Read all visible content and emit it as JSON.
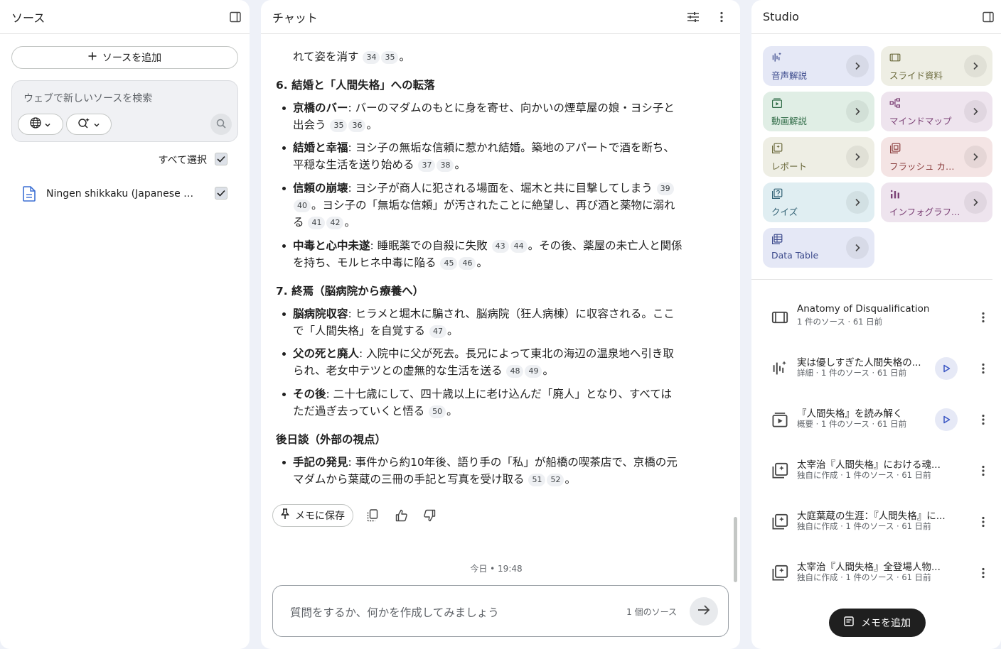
{
  "sources": {
    "title": "ソース",
    "add_label": "ソースを追加",
    "search_placeholder": "ウェブで新しいソースを検索",
    "select_all_label": "すべて選択",
    "items": [
      {
        "name": "Ningen shikkaku (Japanese Edi..."
      }
    ]
  },
  "chat": {
    "title": "チャット",
    "content": {
      "lead_text": "れて姿を消す",
      "lead_cites": [
        "34",
        "35"
      ],
      "lead_end": "。",
      "sections": [
        {
          "heading": "6. 結婚と「人間失格」への転落",
          "bullets": [
            {
              "term": "京橋のバー",
              "line1": ": バーのマダムのもとに身を寄せ、向かいの煙草屋の娘・ヨシ子と",
              "line2": "出会う",
              "cites": [
                "35",
                "36"
              ],
              "end": "。"
            },
            {
              "term": "結婚と幸福",
              "line1": ": ヨシ子の無垢な信頼に惹かれ結婚。築地のアパートで酒を断ち、",
              "line2": "平穏な生活を送り始める",
              "cites": [
                "37",
                "38"
              ],
              "end": "。"
            },
            {
              "term": "信頼の崩壊",
              "line1": ": ヨシ子が商人に犯される場面を、堀木と共に目撃してしまう",
              "cite_a": "39",
              "cite_b": "40",
              "line2": "。ヨシ子の「無垢な信頼」が汚されたことに絶望し、再び酒と薬物に溺れ",
              "line3": "る",
              "cites": [
                "41",
                "42"
              ],
              "end": "。"
            },
            {
              "term": "中毒と心中未遂",
              "line1": ": 睡眠薬での自殺に失敗",
              "cite_a": "43",
              "cite_b": "44",
              "line1b": "。その後、薬屋の未亡人と関係",
              "line2": "を持ち、モルヒネ中毒に陥る",
              "cites": [
                "45",
                "46"
              ],
              "end": "。"
            }
          ]
        },
        {
          "heading": "7. 終焉（脳病院から療養へ）",
          "bullets": [
            {
              "term": "脳病院収容",
              "line1": ": ヒラメと堀木に騙され、脳病院（狂人病棟）に収容される。ここ",
              "line2": "で「人間失格」を自覚する",
              "cites": [
                "47"
              ],
              "end": "。"
            },
            {
              "term": "父の死と廃人",
              "line1": ": 入院中に父が死去。長兄によって東北の海辺の温泉地へ引き取",
              "line2": "られ、老女中テツとの虚無的な生活を送る",
              "cites": [
                "48",
                "49"
              ],
              "end": "。"
            },
            {
              "term": "その後",
              "line1": ": 二十七歳にして、四十歳以上に老け込んだ「廃人」となり、すべては",
              "line2": "ただ過ぎ去っていくと悟る",
              "cites": [
                "50"
              ],
              "end": "。"
            }
          ]
        },
        {
          "heading": "後日談（外部の視点）",
          "bullets": [
            {
              "term": "手記の発見",
              "line1": ": 事件から約10年後、語り手の「私」が船橋の喫茶店で、京橋の元",
              "line2": "マダムから葉蔵の三冊の手記と写真を受け取る",
              "cites": [
                "51",
                "52"
              ],
              "end": "。"
            }
          ]
        }
      ]
    },
    "save_memo_label": "メモに保存",
    "timestamp": "今日 • 19:48",
    "input_placeholder": "質問をするか、何かを作成してみましょう",
    "source_count": "1 個のソース"
  },
  "studio": {
    "title": "Studio",
    "tiles": [
      {
        "label": "音声解説",
        "icon": "audio-sparkle-icon",
        "bg": "#e5e8f6",
        "color": "#3c4a8c"
      },
      {
        "label": "スライド資料",
        "icon": "slides-icon",
        "bg": "#eeeee4",
        "color": "#6b6a3c"
      },
      {
        "label": "動画解説",
        "icon": "video-icon",
        "bg": "#e0eee5",
        "color": "#2f6b46"
      },
      {
        "label": "マインドマップ",
        "icon": "mindmap-icon",
        "bg": "#eee4ee",
        "color": "#7a3f74"
      },
      {
        "label": "レポート",
        "icon": "report-icon",
        "bg": "#eeeee4",
        "color": "#6b6a3c"
      },
      {
        "label": "フラッシュ カード",
        "icon": "flashcard-icon",
        "bg": "#f4e4e4",
        "color": "#8c3f3f"
      },
      {
        "label": "クイズ",
        "icon": "quiz-icon",
        "bg": "#e0eef2",
        "color": "#2f5f72"
      },
      {
        "label": "インフォグラフィ...",
        "icon": "infographic-icon",
        "bg": "#eee4ee",
        "color": "#7a3f74"
      },
      {
        "label": "Data Table",
        "icon": "table-icon",
        "bg": "#e5e8f6",
        "color": "#3c4a8c"
      }
    ],
    "notes": [
      {
        "title": "Anatomy of Disqualification",
        "sub": "1 件のソース · 61 日前",
        "icon": "slides-icon",
        "play": false
      },
      {
        "title": "実は優しすぎた人間失格の...",
        "sub": "詳細 · 1 件のソース · 61 日前",
        "icon": "audio-sparkle-icon",
        "play": true
      },
      {
        "title": "『人間失格』を読み解く",
        "sub": "概要 · 1 件のソース · 61 日前",
        "icon": "video-icon",
        "play": true
      },
      {
        "title": "太宰治『人間失格』における魂...",
        "sub": "独自に作成 · 1 件のソース · 61 日前",
        "icon": "report-icon",
        "play": false
      },
      {
        "title": "大庭葉蔵の生涯：『人間失格』に...",
        "sub": "独自に作成 · 1 件のソース · 61 日前",
        "icon": "report-icon",
        "play": false
      },
      {
        "title": "太宰治『人間失格』全登場人物...",
        "sub": "独自に作成 · 1 件のソース · 61 日前",
        "icon": "report-icon",
        "play": false
      }
    ],
    "add_memo_label": "メモを追加"
  }
}
